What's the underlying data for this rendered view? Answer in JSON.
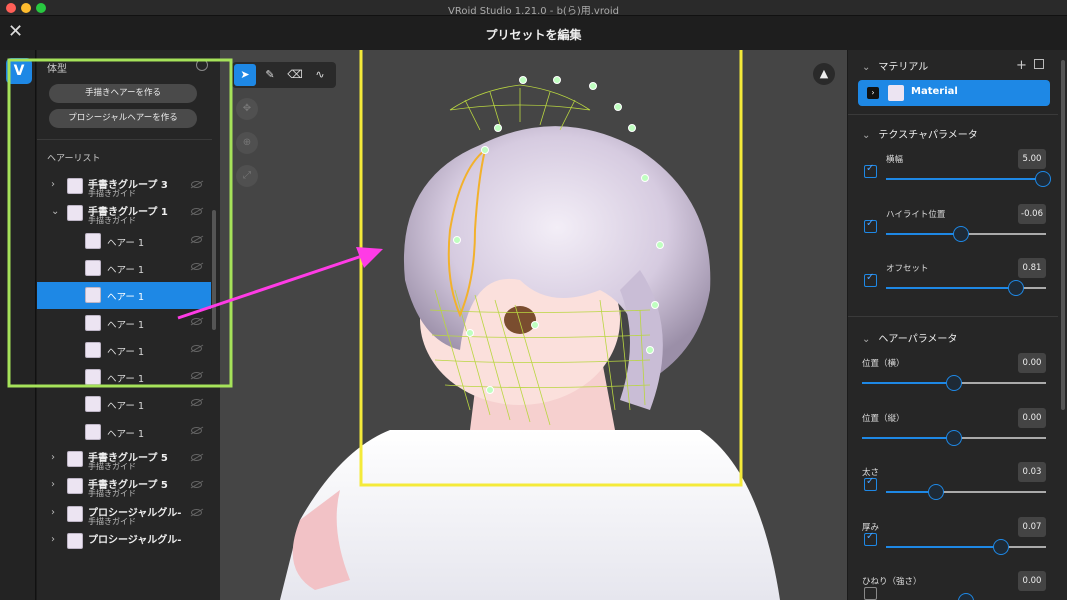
{
  "window": {
    "title": "VRoid Studio 1.21.0 - b(ら)用.vroid"
  },
  "topbar": {
    "title": "プリセットを編集"
  },
  "left_panel": {
    "header": "体型",
    "buttons": [
      "手描きヘアーを作る",
      "プロシージャルヘアーを作る"
    ],
    "list_title": "ヘアーリスト",
    "rows": [
      {
        "kind": "group",
        "expanded": false,
        "name": "手書きグループ 3",
        "sub": "手描きガイド",
        "selected": false
      },
      {
        "kind": "group",
        "expanded": true,
        "name": "手書きグループ 1",
        "sub": "手描きガイド",
        "selected": false
      },
      {
        "kind": "hair",
        "name": "ヘアー 1",
        "selected": false
      },
      {
        "kind": "hair",
        "name": "ヘアー 1",
        "selected": false
      },
      {
        "kind": "hair",
        "name": "ヘアー 1",
        "selected": true
      },
      {
        "kind": "hair",
        "name": "ヘアー 1",
        "selected": false
      },
      {
        "kind": "hair",
        "name": "ヘアー 1",
        "selected": false
      },
      {
        "kind": "hair",
        "name": "ヘアー 1",
        "selected": false
      },
      {
        "kind": "hair",
        "name": "ヘアー 1",
        "selected": false
      },
      {
        "kind": "hair",
        "name": "ヘアー 1",
        "selected": false
      },
      {
        "kind": "group",
        "expanded": false,
        "name": "手書きグループ 5",
        "sub": "手描きガイド",
        "selected": false
      },
      {
        "kind": "group",
        "expanded": false,
        "name": "手書きグループ 5",
        "sub": "手描きガイド",
        "selected": false
      },
      {
        "kind": "group",
        "expanded": false,
        "name": "プロシージャルグル-",
        "sub": "手描きガイド",
        "selected": false
      },
      {
        "kind": "group",
        "expanded": false,
        "name": "プロシージャルグル-",
        "sub": "",
        "selected": false
      }
    ]
  },
  "viewport": {
    "tools": [
      "select-icon",
      "pen-icon",
      "eraser-icon",
      "curve-icon"
    ],
    "nav": [
      "move-icon",
      "zoom-icon",
      "fit-icon"
    ],
    "perspective_icon": "perspective-icon"
  },
  "right_panel": {
    "material": {
      "title": "マテリアル",
      "name": "Material"
    },
    "texture": {
      "title": "テクスチャパラメータ",
      "params": [
        {
          "label": "横幅",
          "value": "5.00",
          "level": 0.98,
          "checked": true
        },
        {
          "label": "ハイライト位置",
          "value": "-0.06",
          "level": 0.47,
          "checked": true
        },
        {
          "label": "オフセット",
          "value": "0.81",
          "level": 0.81,
          "checked": true
        }
      ]
    },
    "hair": {
      "title": "ヘアーパラメータ",
      "params": [
        {
          "label": "位置（横）",
          "value": "0.00",
          "level": 0.5,
          "checked": null
        },
        {
          "label": "位置（縦）",
          "value": "0.00",
          "level": 0.5,
          "checked": null
        },
        {
          "label": "太さ",
          "value": "0.03",
          "level": 0.31,
          "checked": true
        },
        {
          "label": "厚み",
          "value": "0.07",
          "level": 0.72,
          "checked": true
        },
        {
          "label": "ひねり（強さ）",
          "value": "0.00",
          "level": 0.5,
          "checked": false
        }
      ]
    }
  },
  "colors": {
    "accent": "#1e88e5",
    "highlight_yellow": "#f4ea3a",
    "highlight_green": "#a6e35a",
    "arrow_magenta": "#ff3be6"
  }
}
